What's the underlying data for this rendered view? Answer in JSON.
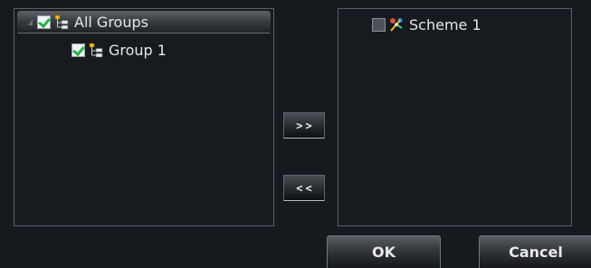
{
  "left_tree": {
    "root": {
      "label": "All Groups",
      "checked": true,
      "icon": "group-tree-icon"
    },
    "children": [
      {
        "label": "Group 1",
        "checked": true,
        "icon": "group-tree-icon"
      }
    ]
  },
  "right_tree": {
    "items": [
      {
        "label": "Scheme 1",
        "checked": false,
        "icon": "scheme-icon"
      }
    ]
  },
  "transfer": {
    "add_label": ">>",
    "remove_label": "<<"
  },
  "dialog": {
    "ok_label": "OK",
    "cancel_label": "Cancel"
  }
}
